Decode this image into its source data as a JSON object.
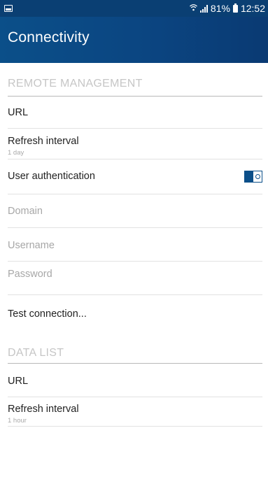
{
  "status_bar": {
    "battery_percent": "81%",
    "time": "12:52",
    "wifi_icon": "wifi-icon",
    "signal_icon": "signal-icon"
  },
  "app_bar": {
    "title": "Connectivity"
  },
  "remote_management": {
    "header": "REMOTE MANAGEMENT",
    "url_label": "URL",
    "refresh_label": "Refresh interval",
    "refresh_value": "1 day",
    "user_auth_label": "User authentication",
    "user_auth_enabled": true,
    "domain_label": "Domain",
    "username_label": "Username",
    "password_label": "Password",
    "test_connection_label": "Test connection..."
  },
  "data_list": {
    "header": "DATA LIST",
    "url_label": "URL",
    "refresh_label": "Refresh interval",
    "refresh_value": "1 hour"
  },
  "colors": {
    "accent": "#0b4f89",
    "status_bar": "#0a3f73",
    "disabled_text": "#a7a7a7"
  }
}
